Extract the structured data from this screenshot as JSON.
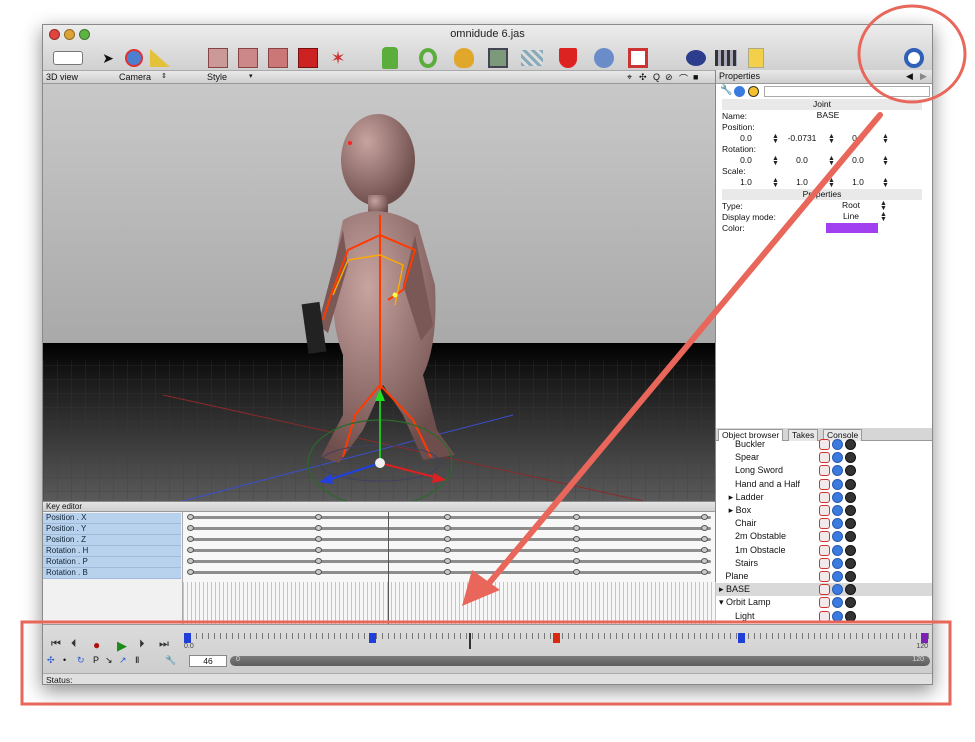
{
  "window": {
    "title": "omnidude 6.jas"
  },
  "viewbar": {
    "view_label": "3D view",
    "camera_label": "Camera",
    "style_label": "Style",
    "nav_icons": [
      "⌖",
      "✣",
      "Q",
      "⊘",
      "⌒",
      "■"
    ]
  },
  "toolbar": {
    "icons": [
      "layout-icon",
      "arrow-tool-icon",
      "transform-tool-icon",
      "ruler-icon",
      "cube1-icon",
      "cube2-icon",
      "cube3-icon",
      "cube4-icon",
      "light-icon",
      "shape1-icon",
      "shape2-icon",
      "shape3-icon",
      "shape4-icon",
      "shape5-icon",
      "shape6-icon",
      "shape7-icon",
      "shape8-icon",
      "render-icon",
      "movie-icon",
      "note-icon",
      "clock-icon"
    ]
  },
  "properties": {
    "header": "Properties",
    "section_joint": "Joint",
    "name_label": "Name:",
    "name_value": "BASE",
    "position_label": "Position:",
    "position": [
      "0.0",
      "-0.0731",
      "0.0"
    ],
    "rotation_label": "Rotation:",
    "rotation": [
      "0.0",
      "0.0",
      "0.0"
    ],
    "scale_label": "Scale:",
    "scale": [
      "1.0",
      "1.0",
      "1.0"
    ],
    "section_props": "Properties",
    "type_label": "Type:",
    "type_value": "Root",
    "display_label": "Display mode:",
    "display_value": "Line",
    "color_label": "Color:",
    "color_value": "#a040f0"
  },
  "object_browser": {
    "tabs": [
      "Object browser",
      "Takes",
      "Console"
    ],
    "items": [
      {
        "label": "Buckler",
        "indent": 1
      },
      {
        "label": "Spear",
        "indent": 1
      },
      {
        "label": "Long Sword",
        "indent": 1
      },
      {
        "label": "Hand and a Half",
        "indent": 1
      },
      {
        "label": "▸ Ladder",
        "indent": 0.6
      },
      {
        "label": "▸ Box",
        "indent": 0.6
      },
      {
        "label": "Chair",
        "indent": 1
      },
      {
        "label": "2m Obstable",
        "indent": 1
      },
      {
        "label": "1m Obstacle",
        "indent": 1
      },
      {
        "label": "Stairs",
        "indent": 1
      },
      {
        "label": "Plane",
        "indent": 0.4
      },
      {
        "label": "▸ BASE",
        "indent": 0
      },
      {
        "label": "▾ Orbit Lamp",
        "indent": 0
      },
      {
        "label": "Light",
        "indent": 1
      }
    ]
  },
  "key_editor": {
    "title": "Key editor",
    "tracks": [
      "Position . X",
      "Position . Y",
      "Position . Z",
      "Rotation . H",
      "Rotation . P",
      "Rotation . B"
    ]
  },
  "transport": {
    "buttons": [
      "⏮",
      "⏴",
      "●",
      "▶",
      "⏵",
      "⏭"
    ],
    "start_frame": "0.0",
    "end_frame": "120",
    "current_frame": "46",
    "slider_start": "0",
    "slider_end": "120",
    "tools": [
      "✣",
      "•",
      "↻",
      "P",
      "↘",
      "↗",
      "Ⅱ",
      "🔧"
    ]
  },
  "status": {
    "label": "Status:"
  }
}
